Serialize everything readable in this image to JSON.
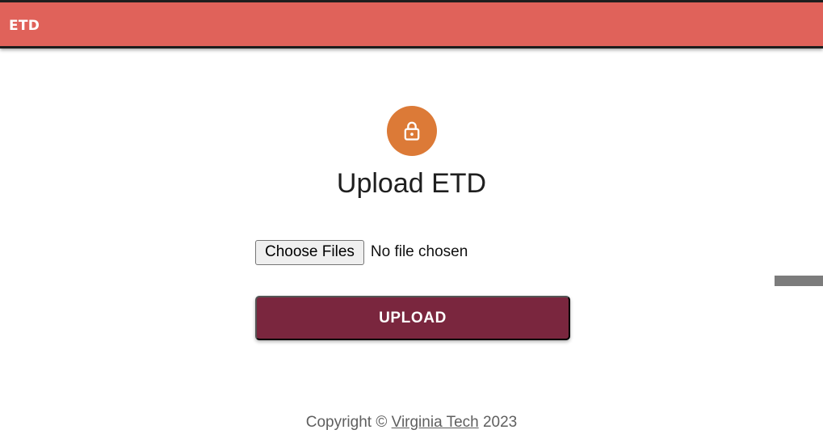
{
  "appbar": {
    "title": "ETD",
    "color": "#e0625a"
  },
  "icon": {
    "name": "lock-icon",
    "color": "#dc7a37"
  },
  "heading": "Upload ETD",
  "file_input": {
    "button_label": "Choose Files",
    "status": "No file chosen"
  },
  "upload_button": {
    "label": "UPLOAD",
    "color": "#7a263e"
  },
  "footer": {
    "prefix": "Copyright ©",
    "link_text": "Virginia Tech",
    "year": "2023"
  }
}
